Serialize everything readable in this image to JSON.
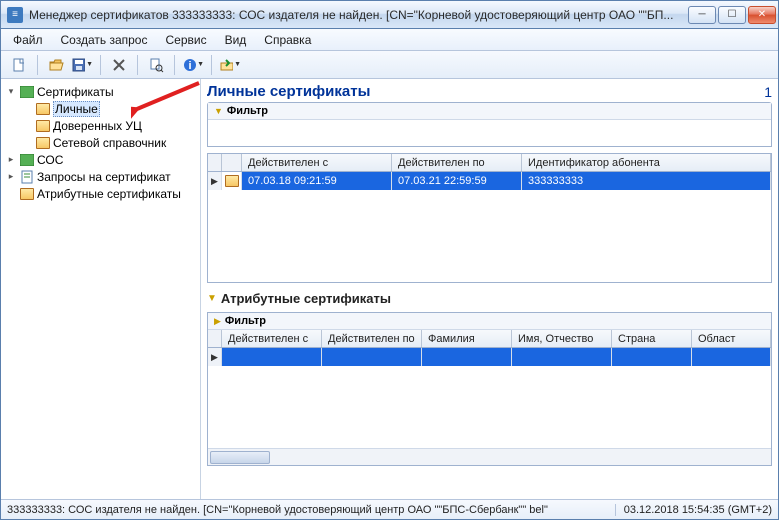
{
  "window": {
    "title": "Менеджер сертификатов   333333333: СОС издателя не найден. [CN=\"Корневой удостоверяющий центр ОАО \"\"БП..."
  },
  "menu": {
    "file": "Файл",
    "create": "Создать запрос",
    "service": "Сервис",
    "view": "Вид",
    "help": "Справка"
  },
  "tree": {
    "root": "Сертификаты",
    "personal": "Личные",
    "trusted": "Доверенных УЦ",
    "network": "Сетевой справочник",
    "crl": "СОС",
    "requests": "Запросы на сертификат",
    "attr": "Атрибутные сертификаты"
  },
  "main": {
    "heading": "Личные сертификаты",
    "count": "1",
    "filter_label": "Фильтр",
    "columns": {
      "valid_from": "Действителен с",
      "valid_to": "Действителен по",
      "subscriber": "Идентификатор абонента"
    },
    "row": {
      "valid_from": "07.03.18 09:21:59",
      "valid_to": "07.03.21 22:59:59",
      "subscriber": "333333333"
    }
  },
  "attr": {
    "section": "Атрибутные сертификаты",
    "filter_label": "Фильтр",
    "columns": {
      "valid_from": "Действителен с",
      "valid_to": "Действителен по",
      "surname": "Фамилия",
      "name": "Имя, Отчество",
      "country": "Страна",
      "region": "Област"
    }
  },
  "status": {
    "message": "333333333: СОС издателя не найден. [CN=\"Корневой удостоверяющий центр ОАО \"\"БПС-Сбербанк\"\" bel\"",
    "time": "03.12.2018 15:54:35 (GMT+2)"
  }
}
